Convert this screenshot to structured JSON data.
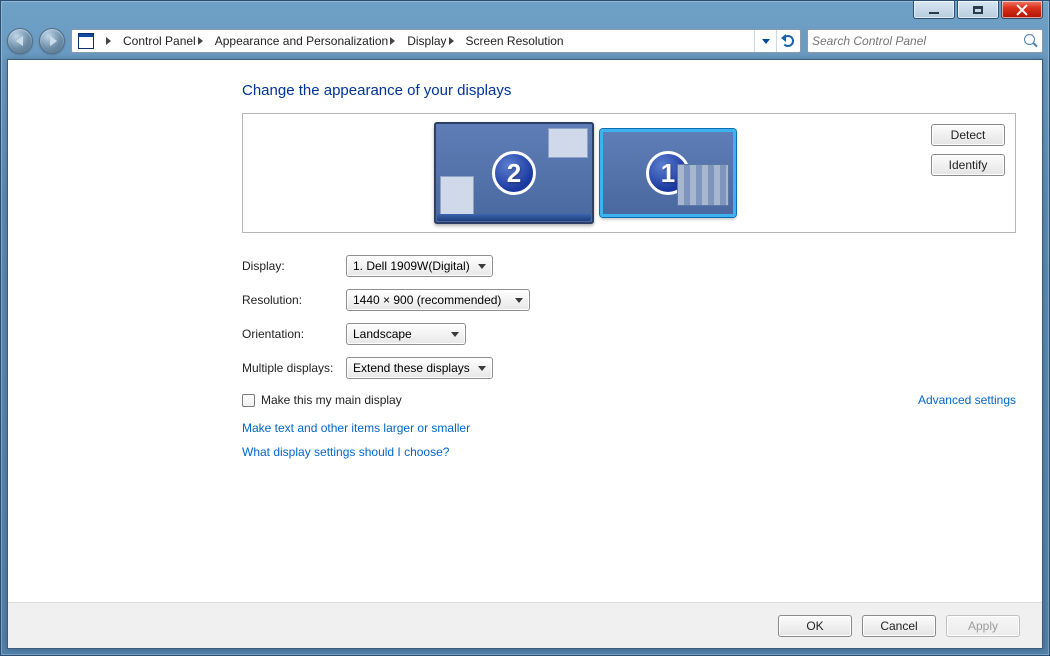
{
  "window": {
    "minimize_tooltip": "Minimize",
    "maximize_tooltip": "Maximize",
    "close_tooltip": "Close"
  },
  "nav": {
    "breadcrumbs": [
      "Control Panel",
      "Appearance and Personalization",
      "Display",
      "Screen Resolution"
    ],
    "search_placeholder": "Search Control Panel"
  },
  "page": {
    "title": "Change the appearance of your displays",
    "detect_label": "Detect",
    "identify_label": "Identify",
    "monitors": [
      {
        "id": 2,
        "selected": false
      },
      {
        "id": 1,
        "selected": true
      }
    ],
    "fields": {
      "display_label": "Display:",
      "display_value": "1. Dell 1909W(Digital)",
      "resolution_label": "Resolution:",
      "resolution_value": "1440 × 900 (recommended)",
      "orientation_label": "Orientation:",
      "orientation_value": "Landscape",
      "multi_label": "Multiple displays:",
      "multi_value": "Extend these displays"
    },
    "main_display_checkbox": "Make this my main display",
    "advanced_link": "Advanced settings",
    "text_size_link": "Make text and other items larger or smaller",
    "help_link": "What display settings should I choose?",
    "buttons": {
      "ok": "OK",
      "cancel": "Cancel",
      "apply": "Apply"
    }
  }
}
